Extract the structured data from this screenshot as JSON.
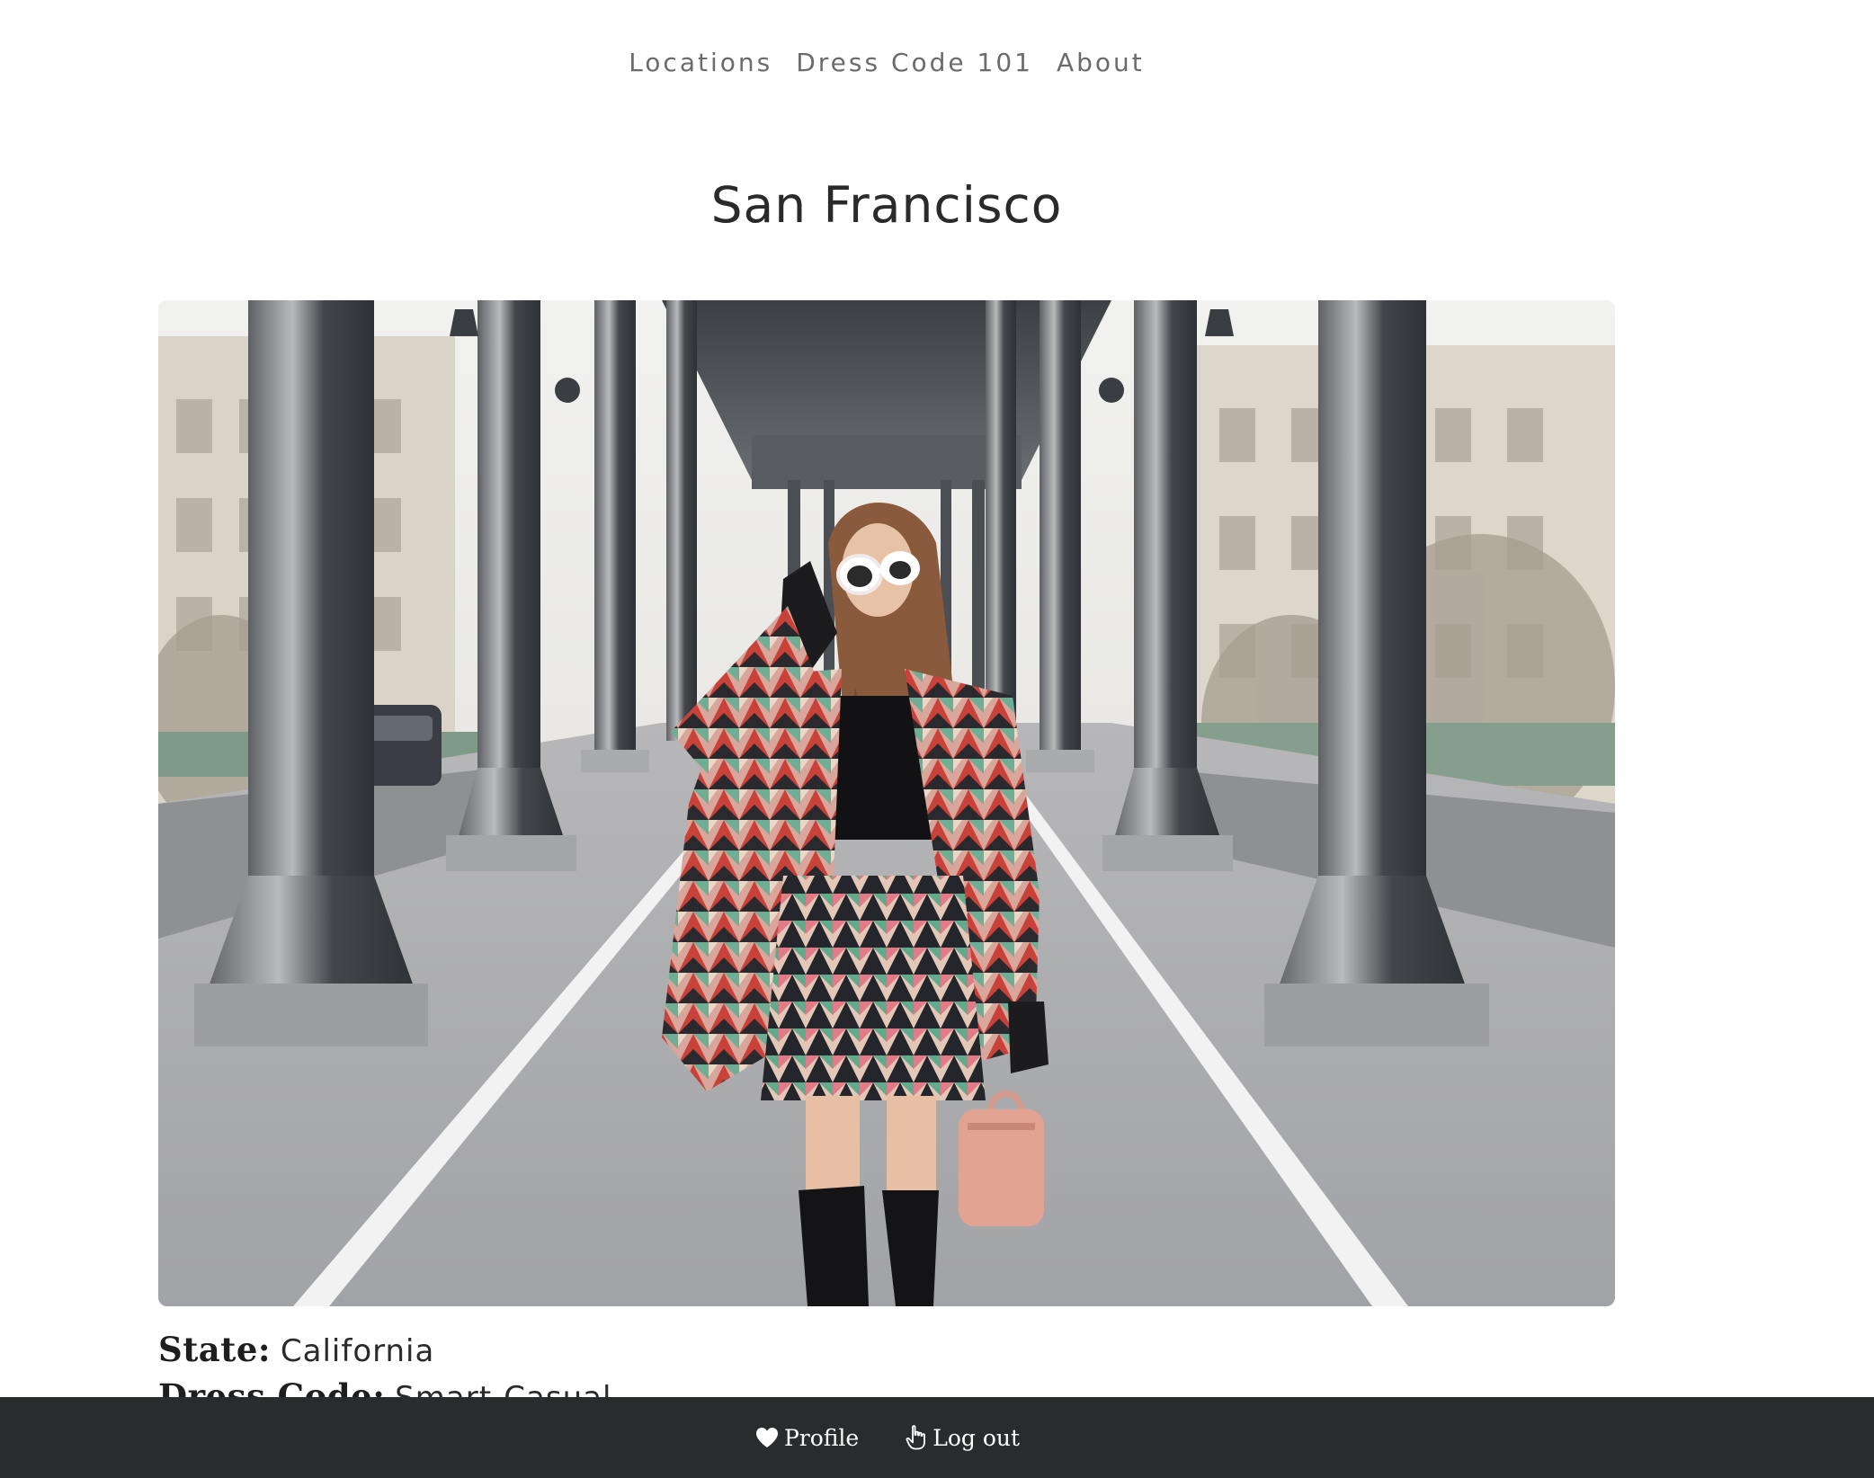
{
  "nav": {
    "items": [
      {
        "label": "Locations"
      },
      {
        "label": "Dress Code 101"
      },
      {
        "label": "About"
      }
    ]
  },
  "page": {
    "title": "San Francisco"
  },
  "hero": {
    "alt": "Woman in a geometric-print coat and skirt with white sunglasses and a pink handbag, standing under a steel colonnade bridge"
  },
  "details": {
    "state_label": "State:",
    "state_value": "California",
    "dress_code_label": "Dress Code:",
    "dress_code_value": "Smart-Casual"
  },
  "footer_bar": {
    "profile_label": "Profile",
    "logout_label": "Log out",
    "profile_icon": "heart-icon",
    "logout_icon": "hand-pointer-icon"
  },
  "colors": {
    "bar_background": "#2a2b2d",
    "nav_text": "#6b6b6b",
    "title_text": "#2a2a2a"
  }
}
